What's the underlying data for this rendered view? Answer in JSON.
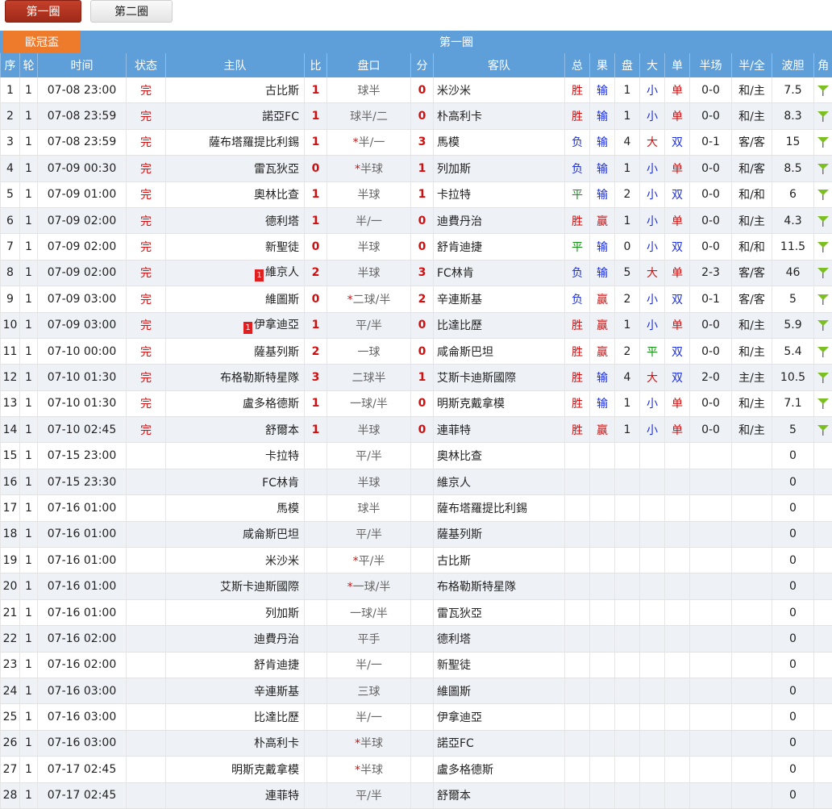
{
  "tabs": [
    "第一圈",
    "第二圈"
  ],
  "league": "歐冠盃",
  "round_title": "第一圈",
  "headers": [
    "序",
    "轮",
    "时间",
    "状态",
    "主队",
    "比",
    "盘口",
    "分",
    "客队",
    "总",
    "果",
    "盘",
    "大",
    "单",
    "半场",
    "半/全",
    "波胆",
    "角"
  ],
  "colors": {
    "header_bg": "#5f9fd9",
    "cup_bg": "#ee7a2b",
    "tab_active": "#b0321f",
    "red": "#d01010",
    "blue": "#1d2ed8",
    "green": "#109010"
  },
  "rows": [
    {
      "no": "1",
      "rnd": "1",
      "time": "07-08 23:00",
      "status": "完",
      "home_card": "",
      "home": "古比斯",
      "hs": "1",
      "star": "",
      "hcap": "球半",
      "as": "0",
      "away": "米沙米",
      "total": "胜",
      "res": "输",
      "pan": "1",
      "big": "小",
      "odd": "单",
      "half": "0-0",
      "hf": "和/主",
      "wave": "7.5",
      "corner": true
    },
    {
      "no": "2",
      "rnd": "1",
      "time": "07-08 23:59",
      "status": "完",
      "home_card": "",
      "home": "諾亞FC",
      "hs": "1",
      "star": "",
      "hcap": "球半/二",
      "as": "0",
      "away": "朴高利卡",
      "total": "胜",
      "res": "输",
      "pan": "1",
      "big": "小",
      "odd": "单",
      "half": "0-0",
      "hf": "和/主",
      "wave": "8.3",
      "corner": true
    },
    {
      "no": "3",
      "rnd": "1",
      "time": "07-08 23:59",
      "status": "完",
      "home_card": "",
      "home": "薩布塔羅提比利錫",
      "hs": "1",
      "star": "*",
      "hcap": "半/一",
      "as": "3",
      "away": "馬模",
      "total": "负",
      "res": "输",
      "pan": "4",
      "big": "大",
      "odd": "双",
      "half": "0-1",
      "hf": "客/客",
      "wave": "15",
      "corner": true
    },
    {
      "no": "4",
      "rnd": "1",
      "time": "07-09 00:30",
      "status": "完",
      "home_card": "",
      "home": "雷瓦狄亞",
      "hs": "0",
      "star": "*",
      "hcap": "半球",
      "as": "1",
      "away": "列加斯",
      "total": "负",
      "res": "输",
      "pan": "1",
      "big": "小",
      "odd": "单",
      "half": "0-0",
      "hf": "和/客",
      "wave": "8.5",
      "corner": true
    },
    {
      "no": "5",
      "rnd": "1",
      "time": "07-09 01:00",
      "status": "完",
      "home_card": "",
      "home": "奧林比查",
      "hs": "1",
      "star": "",
      "hcap": "半球",
      "as": "1",
      "away": "卡拉特",
      "total": "平",
      "res": "输",
      "pan": "2",
      "big": "小",
      "odd": "双",
      "half": "0-0",
      "hf": "和/和",
      "wave": "6",
      "corner": true
    },
    {
      "no": "6",
      "rnd": "1",
      "time": "07-09 02:00",
      "status": "完",
      "home_card": "",
      "home": "德利塔",
      "hs": "1",
      "star": "",
      "hcap": "半/一",
      "as": "0",
      "away": "迪費丹治",
      "total": "胜",
      "res": "赢",
      "pan": "1",
      "big": "小",
      "odd": "单",
      "half": "0-0",
      "hf": "和/主",
      "wave": "4.3",
      "corner": true
    },
    {
      "no": "7",
      "rnd": "1",
      "time": "07-09 02:00",
      "status": "完",
      "home_card": "",
      "home": "新聖徒",
      "hs": "0",
      "star": "",
      "hcap": "半球",
      "as": "0",
      "away": "舒肯迪捷",
      "total": "平",
      "res": "输",
      "pan": "0",
      "big": "小",
      "odd": "双",
      "half": "0-0",
      "hf": "和/和",
      "wave": "11.5",
      "corner": true
    },
    {
      "no": "8",
      "rnd": "1",
      "time": "07-09 02:00",
      "status": "完",
      "home_card": "1",
      "home": "維京人",
      "hs": "2",
      "star": "",
      "hcap": "半球",
      "as": "3",
      "away": "FC林肯",
      "total": "负",
      "res": "输",
      "pan": "5",
      "big": "大",
      "odd": "单",
      "half": "2-3",
      "hf": "客/客",
      "wave": "46",
      "corner": true
    },
    {
      "no": "9",
      "rnd": "1",
      "time": "07-09 03:00",
      "status": "完",
      "home_card": "",
      "home": "維圖斯",
      "hs": "0",
      "star": "*",
      "hcap": "二球/半",
      "as": "2",
      "away": "辛連斯基",
      "total": "负",
      "res": "赢",
      "pan": "2",
      "big": "小",
      "odd": "双",
      "half": "0-1",
      "hf": "客/客",
      "wave": "5",
      "corner": true
    },
    {
      "no": "10",
      "rnd": "1",
      "time": "07-09 03:00",
      "status": "完",
      "home_card": "1",
      "home": "伊拿迪亞",
      "hs": "1",
      "star": "",
      "hcap": "平/半",
      "as": "0",
      "away": "比達比歷",
      "total": "胜",
      "res": "赢",
      "pan": "1",
      "big": "小",
      "odd": "单",
      "half": "0-0",
      "hf": "和/主",
      "wave": "5.9",
      "corner": true
    },
    {
      "no": "11",
      "rnd": "1",
      "time": "07-10 00:00",
      "status": "完",
      "home_card": "",
      "home": "薩基列斯",
      "hs": "2",
      "star": "",
      "hcap": "一球",
      "as": "0",
      "away": "咸侖斯巴坦",
      "total": "胜",
      "res": "赢",
      "pan": "2",
      "big": "平",
      "odd": "双",
      "half": "0-0",
      "hf": "和/主",
      "wave": "5.4",
      "corner": true
    },
    {
      "no": "12",
      "rnd": "1",
      "time": "07-10 01:30",
      "status": "完",
      "home_card": "",
      "home": "布格勒斯特星隊",
      "hs": "3",
      "star": "",
      "hcap": "二球半",
      "as": "1",
      "away": "艾斯卡迪斯國際",
      "total": "胜",
      "res": "输",
      "pan": "4",
      "big": "大",
      "odd": "双",
      "half": "2-0",
      "hf": "主/主",
      "wave": "10.5",
      "corner": true
    },
    {
      "no": "13",
      "rnd": "1",
      "time": "07-10 01:30",
      "status": "完",
      "home_card": "",
      "home": "盧多格德斯",
      "hs": "1",
      "star": "",
      "hcap": "一球/半",
      "as": "0",
      "away": "明斯克戴拿模",
      "total": "胜",
      "res": "输",
      "pan": "1",
      "big": "小",
      "odd": "单",
      "half": "0-0",
      "hf": "和/主",
      "wave": "7.1",
      "corner": true
    },
    {
      "no": "14",
      "rnd": "1",
      "time": "07-10 02:45",
      "status": "完",
      "home_card": "",
      "home": "舒爾本",
      "hs": "1",
      "star": "",
      "hcap": "半球",
      "as": "0",
      "away": "連菲特",
      "total": "胜",
      "res": "赢",
      "pan": "1",
      "big": "小",
      "odd": "单",
      "half": "0-0",
      "hf": "和/主",
      "wave": "5",
      "corner": true
    },
    {
      "no": "15",
      "rnd": "1",
      "time": "07-15 23:00",
      "status": "",
      "home_card": "",
      "home": "卡拉特",
      "hs": "",
      "star": "",
      "hcap": "平/半",
      "as": "",
      "away": "奧林比查",
      "total": "",
      "res": "",
      "pan": "",
      "big": "",
      "odd": "",
      "half": "",
      "hf": "",
      "wave": "0",
      "corner": false
    },
    {
      "no": "16",
      "rnd": "1",
      "time": "07-15 23:30",
      "status": "",
      "home_card": "",
      "home": "FC林肯",
      "hs": "",
      "star": "",
      "hcap": "半球",
      "as": "",
      "away": "維京人",
      "total": "",
      "res": "",
      "pan": "",
      "big": "",
      "odd": "",
      "half": "",
      "hf": "",
      "wave": "0",
      "corner": false
    },
    {
      "no": "17",
      "rnd": "1",
      "time": "07-16 01:00",
      "status": "",
      "home_card": "",
      "home": "馬模",
      "hs": "",
      "star": "",
      "hcap": "球半",
      "as": "",
      "away": "薩布塔羅提比利錫",
      "total": "",
      "res": "",
      "pan": "",
      "big": "",
      "odd": "",
      "half": "",
      "hf": "",
      "wave": "0",
      "corner": false
    },
    {
      "no": "18",
      "rnd": "1",
      "time": "07-16 01:00",
      "status": "",
      "home_card": "",
      "home": "咸侖斯巴坦",
      "hs": "",
      "star": "",
      "hcap": "平/半",
      "as": "",
      "away": "薩基列斯",
      "total": "",
      "res": "",
      "pan": "",
      "big": "",
      "odd": "",
      "half": "",
      "hf": "",
      "wave": "0",
      "corner": false
    },
    {
      "no": "19",
      "rnd": "1",
      "time": "07-16 01:00",
      "status": "",
      "home_card": "",
      "home": "米沙米",
      "hs": "",
      "star": "*",
      "hcap": "平/半",
      "as": "",
      "away": "古比斯",
      "total": "",
      "res": "",
      "pan": "",
      "big": "",
      "odd": "",
      "half": "",
      "hf": "",
      "wave": "0",
      "corner": false
    },
    {
      "no": "20",
      "rnd": "1",
      "time": "07-16 01:00",
      "status": "",
      "home_card": "",
      "home": "艾斯卡迪斯國際",
      "hs": "",
      "star": "*",
      "hcap": "一球/半",
      "as": "",
      "away": "布格勒斯特星隊",
      "total": "",
      "res": "",
      "pan": "",
      "big": "",
      "odd": "",
      "half": "",
      "hf": "",
      "wave": "0",
      "corner": false
    },
    {
      "no": "21",
      "rnd": "1",
      "time": "07-16 01:00",
      "status": "",
      "home_card": "",
      "home": "列加斯",
      "hs": "",
      "star": "",
      "hcap": "一球/半",
      "as": "",
      "away": "雷瓦狄亞",
      "total": "",
      "res": "",
      "pan": "",
      "big": "",
      "odd": "",
      "half": "",
      "hf": "",
      "wave": "0",
      "corner": false
    },
    {
      "no": "22",
      "rnd": "1",
      "time": "07-16 02:00",
      "status": "",
      "home_card": "",
      "home": "迪費丹治",
      "hs": "",
      "star": "",
      "hcap": "平手",
      "as": "",
      "away": "德利塔",
      "total": "",
      "res": "",
      "pan": "",
      "big": "",
      "odd": "",
      "half": "",
      "hf": "",
      "wave": "0",
      "corner": false
    },
    {
      "no": "23",
      "rnd": "1",
      "time": "07-16 02:00",
      "status": "",
      "home_card": "",
      "home": "舒肯迪捷",
      "hs": "",
      "star": "",
      "hcap": "半/一",
      "as": "",
      "away": "新聖徒",
      "total": "",
      "res": "",
      "pan": "",
      "big": "",
      "odd": "",
      "half": "",
      "hf": "",
      "wave": "0",
      "corner": false
    },
    {
      "no": "24",
      "rnd": "1",
      "time": "07-16 03:00",
      "status": "",
      "home_card": "",
      "home": "辛連斯基",
      "hs": "",
      "star": "",
      "hcap": "三球",
      "as": "",
      "away": "維圖斯",
      "total": "",
      "res": "",
      "pan": "",
      "big": "",
      "odd": "",
      "half": "",
      "hf": "",
      "wave": "0",
      "corner": false
    },
    {
      "no": "25",
      "rnd": "1",
      "time": "07-16 03:00",
      "status": "",
      "home_card": "",
      "home": "比達比歷",
      "hs": "",
      "star": "",
      "hcap": "半/一",
      "as": "",
      "away": "伊拿迪亞",
      "total": "",
      "res": "",
      "pan": "",
      "big": "",
      "odd": "",
      "half": "",
      "hf": "",
      "wave": "0",
      "corner": false
    },
    {
      "no": "26",
      "rnd": "1",
      "time": "07-16 03:00",
      "status": "",
      "home_card": "",
      "home": "朴高利卡",
      "hs": "",
      "star": "*",
      "hcap": "半球",
      "as": "",
      "away": "諾亞FC",
      "total": "",
      "res": "",
      "pan": "",
      "big": "",
      "odd": "",
      "half": "",
      "hf": "",
      "wave": "0",
      "corner": false
    },
    {
      "no": "27",
      "rnd": "1",
      "time": "07-17 02:45",
      "status": "",
      "home_card": "",
      "home": "明斯克戴拿模",
      "hs": "",
      "star": "*",
      "hcap": "半球",
      "as": "",
      "away": "盧多格德斯",
      "total": "",
      "res": "",
      "pan": "",
      "big": "",
      "odd": "",
      "half": "",
      "hf": "",
      "wave": "0",
      "corner": false
    },
    {
      "no": "28",
      "rnd": "1",
      "time": "07-17 02:45",
      "status": "",
      "home_card": "",
      "home": "連菲特",
      "hs": "",
      "star": "",
      "hcap": "平/半",
      "as": "",
      "away": "舒爾本",
      "total": "",
      "res": "",
      "pan": "",
      "big": "",
      "odd": "",
      "half": "",
      "hf": "",
      "wave": "0",
      "corner": false
    }
  ]
}
